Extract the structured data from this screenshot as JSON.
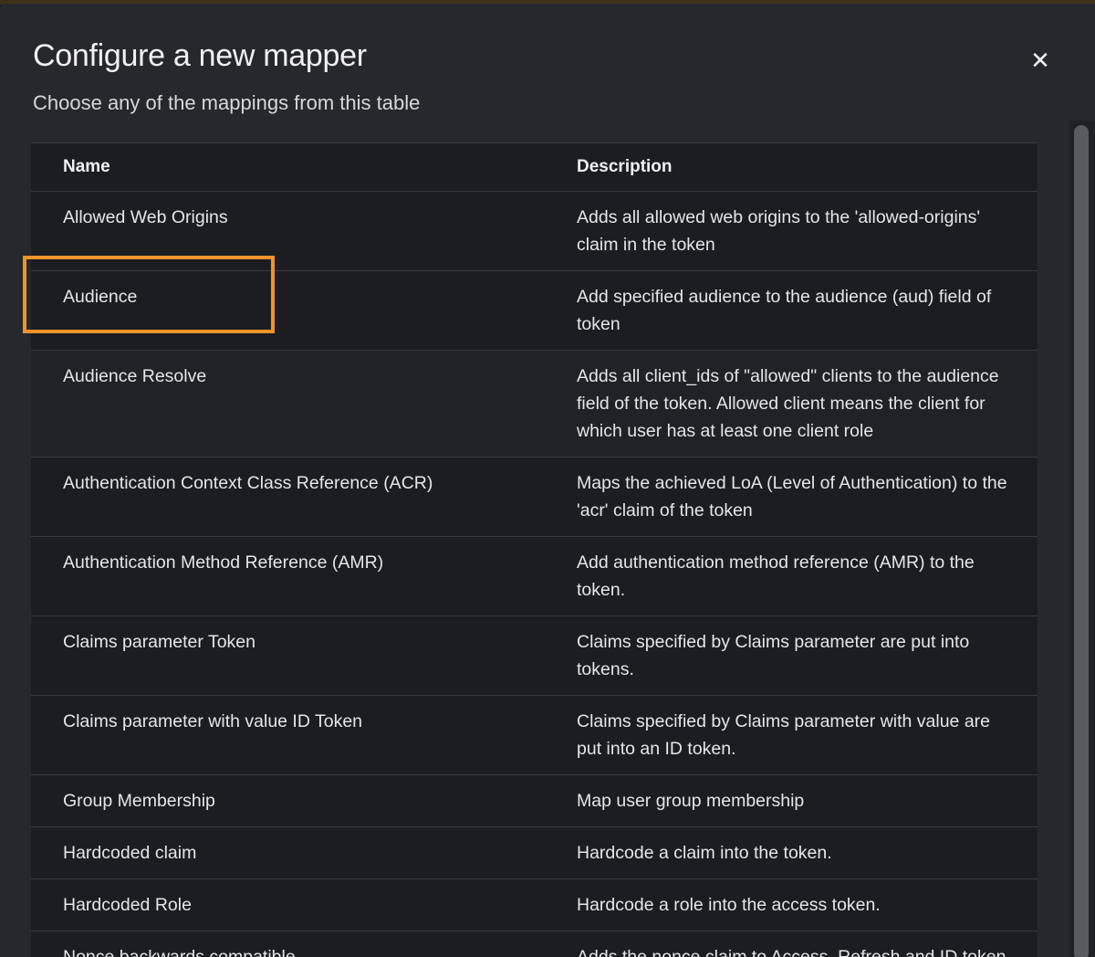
{
  "modal": {
    "title": "Configure a new mapper",
    "subtitle": "Choose any of the mappings from this table",
    "close_icon": "close-icon",
    "close_glyph": "✕"
  },
  "table": {
    "headers": {
      "name": "Name",
      "description": "Description"
    },
    "rows": [
      {
        "name": "Allowed Web Origins",
        "description": "Adds all allowed web origins to the 'allowed-origins' claim in the token"
      },
      {
        "name": "Audience",
        "description": "Add specified audience to the audience (aud) field of token"
      },
      {
        "name": "Audience Resolve",
        "description": "Adds all client_ids of \"allowed\" clients to the audience field of the token. Allowed client means the client for which user has at least one client role"
      },
      {
        "name": "Authentication Context Class Reference (ACR)",
        "description": "Maps the achieved LoA (Level of Authentication) to the 'acr' claim of the token"
      },
      {
        "name": "Authentication Method Reference (AMR)",
        "description": "Add authentication method reference (AMR) to the token."
      },
      {
        "name": "Claims parameter Token",
        "description": "Claims specified by Claims parameter are put into tokens."
      },
      {
        "name": "Claims parameter with value ID Token",
        "description": "Claims specified by Claims parameter with value are put into an ID token."
      },
      {
        "name": "Group Membership",
        "description": "Map user group membership"
      },
      {
        "name": "Hardcoded claim",
        "description": "Hardcode a claim into the token."
      },
      {
        "name": "Hardcoded Role",
        "description": "Hardcode a role into the access token."
      },
      {
        "name": "Nonce backwards compatible",
        "description": "Adds the nonce claim to Access, Refresh and ID token"
      }
    ]
  },
  "colors": {
    "highlight": "#f0942a",
    "modal_bg": "#26282c",
    "table_bg": "#1b1d21"
  }
}
